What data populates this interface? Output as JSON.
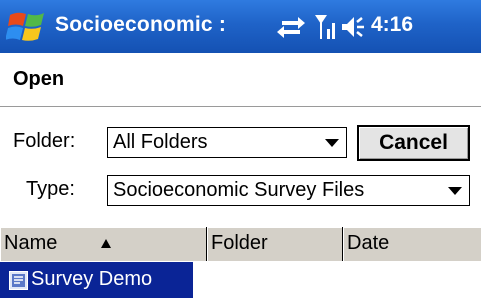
{
  "titlebar": {
    "app_title": "Socioeconomic :",
    "time": "4:16",
    "bg_color": "#1f63c8",
    "icons": [
      "windows-start-icon",
      "sync-icon",
      "signal-icon",
      "volume-icon"
    ]
  },
  "dialog": {
    "title": "Open",
    "folder_label": "Folder:",
    "folder_value": "All Folders",
    "type_label": "Type:",
    "type_value": "Socioeconomic Survey Files",
    "cancel_label": "Cancel"
  },
  "list": {
    "columns": [
      {
        "label": "Name",
        "sorted": "ascending"
      },
      {
        "label": "Folder"
      },
      {
        "label": "Date"
      }
    ],
    "rows": [
      {
        "name": "Survey Demo",
        "selected": true
      }
    ],
    "selection_color": "#0a2496"
  }
}
